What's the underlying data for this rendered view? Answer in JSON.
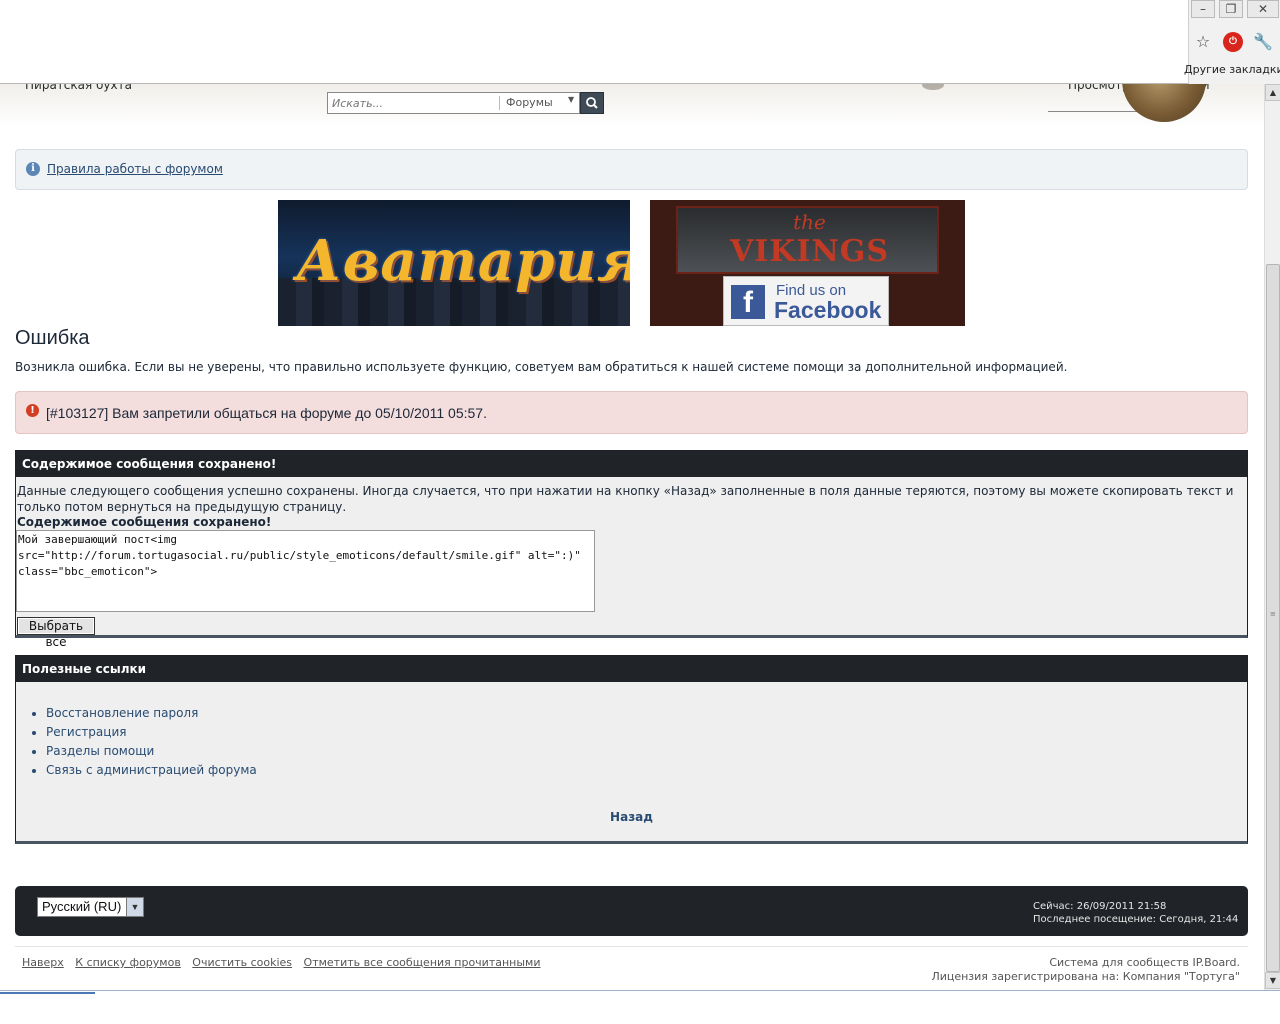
{
  "header": {
    "site_name": "Пиратская бухта",
    "right_text": "Просмотр публикаций",
    "search_placeholder": "Искать...",
    "search_scope": "Форумы"
  },
  "browser": {
    "other_bookmarks": "Другие закладки",
    "window_controls": [
      "–",
      "❐",
      "✕"
    ]
  },
  "rules_link": "Правила работы с форумом",
  "error": {
    "title": "Ошибка",
    "description": "Возникла ошибка. Если вы не уверены, что правильно используете функцию, советуем вам обратиться к нашей системе помощи за дополнительной информацией.",
    "message": "[#103127] Вам запретили общаться на форуме до 05/10/2011 05:57."
  },
  "saved": {
    "heading": "Содержимое сообщения сохранено!",
    "description": "Данные следующего сообщения успешно сохранены. Иногда случается, что при нажатии на кнопку «Назад» заполненные в поля данные теряются, поэтому вы можете скопировать текст и только потом вернуться на предыдущую страницу.",
    "label": "Содержимое сообщения сохранено!",
    "content": "Мой завершающий пост<img src=\"http://forum.tortugasocial.ru/public/style_emoticons/default/smile.gif\" alt=\":)\" class=\"bbc_emoticon\">",
    "select_all": "Выбрать все"
  },
  "useful_links": {
    "heading": "Полезные ссылки",
    "items": [
      "Восстановление пароля",
      "Регистрация",
      "Разделы помощи",
      "Связь с администрацией форума"
    ],
    "back": "Назад"
  },
  "footer": {
    "language": "Русский (RU)",
    "time_now": "Сейчас: 26/09/2011 21:58",
    "last_visit": "Последнее посещение: Сегодня, 21:44",
    "links": [
      "Наверх",
      "К списку форумов",
      "Очистить cookies",
      "Отметить все сообщения прочитанными"
    ],
    "credit_line1": "Система для сообществ IP.Board.",
    "credit_line2": "Лицензия зарегистрирована на: Компания \"Тортуга\""
  },
  "banners": {
    "avataria": "Аватария",
    "vikings_the": "the",
    "vikings_name": "VIKINGS",
    "fb_find": "Find us on",
    "fb_name": "Facebook",
    "fb_logo": "f"
  }
}
